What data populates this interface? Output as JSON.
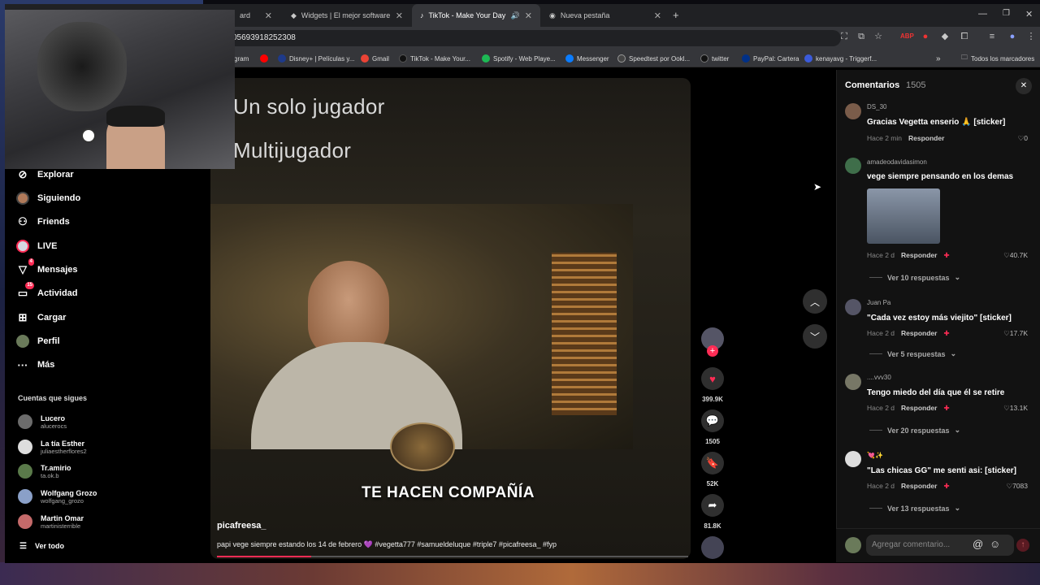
{
  "tabs": [
    {
      "label": "ard",
      "active": false
    },
    {
      "label": "Widgets | El mejor software pa",
      "active": false
    },
    {
      "label": "TikTok - Make Your Day",
      "active": true
    },
    {
      "label": "Nueva pestaña",
      "active": false
    }
  ],
  "address": {
    "url": "05693918252308"
  },
  "bookmarks": [
    {
      "label": "gram",
      "color": "#c13584"
    },
    {
      "label": "",
      "color": "#ff0000"
    },
    {
      "label": "Disney+ | Películas y...",
      "color": "#1e3a8a"
    },
    {
      "label": "Gmail",
      "color": "#ea4335"
    },
    {
      "label": "TikTok - Make Your...",
      "color": "#111111"
    },
    {
      "label": "Spotify - Web Playe...",
      "color": "#1db954"
    },
    {
      "label": "Messenger",
      "color": "#0a7cff"
    },
    {
      "label": "Speedtest por Ookl...",
      "color": "#444444"
    },
    {
      "label": "twitter",
      "color": "#111111"
    },
    {
      "label": "PayPal: Cartera",
      "color": "#003087"
    },
    {
      "label": "kenayavg - Triggerf...",
      "color": "#3b5bdb"
    }
  ],
  "all_bookmarks": "Todos los marcadores",
  "sidebar": {
    "items": [
      {
        "label": "Explorar",
        "icon": "compass-icon"
      },
      {
        "label": "Siguiendo",
        "icon": "following-avatar-icon"
      },
      {
        "label": "Friends",
        "icon": "friends-icon"
      },
      {
        "label": "LIVE",
        "icon": "live-icon"
      },
      {
        "label": "Mensajes",
        "icon": "messages-icon",
        "badge": "4"
      },
      {
        "label": "Actividad",
        "icon": "activity-icon",
        "badge": "15"
      },
      {
        "label": "Cargar",
        "icon": "upload-icon"
      },
      {
        "label": "Perfil",
        "icon": "profile-icon"
      },
      {
        "label": "Más",
        "icon": "more-icon"
      }
    ],
    "following_title": "Cuentas que sigues",
    "accounts": [
      {
        "name": "Lucero",
        "handle": "alucerocs",
        "color": "#6c6c6c"
      },
      {
        "name": "La tía Esther",
        "handle": "juliaestherflores2",
        "color": "#ddd"
      },
      {
        "name": "Tr.amirio",
        "handle": "ta.ok.b",
        "color": "#5a7a4a"
      },
      {
        "name": "Wolfgang Grozo",
        "handle": "wolfgang_grozo",
        "color": "#8aa0c8"
      },
      {
        "name": "Martin Omar",
        "handle": "martinisterrible",
        "color": "#c46a6a"
      }
    ],
    "see_all": "Ver todo"
  },
  "video": {
    "overlay_line1": "Un solo jugador",
    "overlay_line2": "Multijugador",
    "caption_banner": "TE HACEN COMPAÑÍA",
    "author": "picafreesa_",
    "description": "papi vege siempre estando los 14 de febrero 💜 #vegetta777 #samueldeluque #triple7 #picafreesa_ #fyp",
    "progress": 0.2
  },
  "actions": {
    "likes": "399.9K",
    "comments": "1505",
    "saves": "52K",
    "shares": "81.8K"
  },
  "comments_panel": {
    "title": "Comentarios",
    "count": "1505",
    "input_placeholder": "Agregar comentario...",
    "comments": [
      {
        "user": "DS_30",
        "text": "Gracias Vegetta enserio 🙏 [sticker]",
        "time": "Hace 2 min",
        "reply": "Responder",
        "likes": "0",
        "color": "#7a5c4a"
      },
      {
        "user": "amadeodavidasimon",
        "text": "vege siempre pensando en los demas",
        "time": "Hace 2 d",
        "reply": "Responder",
        "likes": "40.7K",
        "more": "Ver 10 respuestas",
        "color": "#3f6e4a"
      },
      {
        "user": "Juan Pa",
        "text": "\"Cada vez estoy más viejito\" [sticker]",
        "time": "Hace 2 d",
        "reply": "Responder",
        "likes": "17.7K",
        "more": "Ver 5 respuestas",
        "color": "#556"
      },
      {
        "user": "....vvv30",
        "text": "Tengo miedo del día que él se retire",
        "time": "Hace 2 d",
        "reply": "Responder",
        "likes": "13.1K",
        "more": "Ver 20 respuestas",
        "color": "#776"
      },
      {
        "user": "💘✨",
        "text": "\"Las chicas GG\" me senti asi: [sticker]",
        "time": "Hace 2 d",
        "reply": "Responder",
        "likes": "7083",
        "more": "Ver 13 respuestas",
        "color": "#ddd"
      }
    ]
  }
}
